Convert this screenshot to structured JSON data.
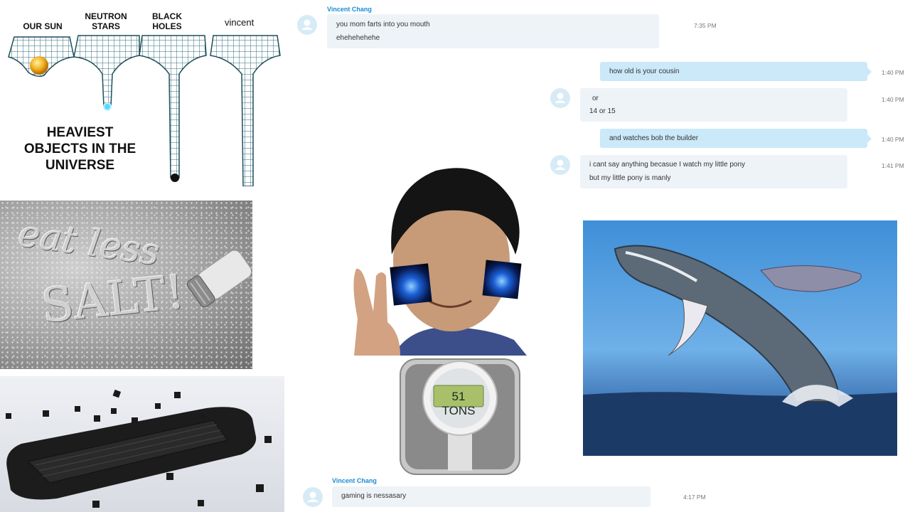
{
  "universe": {
    "labels": [
      "OUR SUN",
      "NEUTRON\nSTARS",
      "BLACK\nHOLES"
    ],
    "vincent_label": "vincent",
    "title": "HEAVIEST\nOBJECTS IN THE\nUNIVERSE"
  },
  "salt": {
    "line1": "eat less",
    "line2": "SALT!"
  },
  "scale": {
    "readout": "51 TONS"
  },
  "chat": {
    "sender_name": "Vincent Chang",
    "messages": [
      {
        "lines": [
          "you mom farts into you mouth",
          "ehehehehehe"
        ],
        "time": "7:35 PM"
      },
      {
        "lines": [
          "how old is your cousin"
        ],
        "time": "1:40 PM"
      },
      {
        "lines": [
          "or",
          "14 or 15"
        ],
        "time": "1:40 PM"
      },
      {
        "lines": [
          "and watches bob the builder"
        ],
        "time": "1:40 PM"
      },
      {
        "lines": [
          "i cant say anything becasue I watch my little pony",
          "but my little pony is manly"
        ],
        "time": "1:41 PM"
      },
      {
        "lines": [
          "gaming is nessasary"
        ],
        "time": "4:17 PM"
      }
    ]
  },
  "icons": [
    "avatar-icon",
    "water-drop-icon"
  ],
  "colors": {
    "sender": "#1a8bd1",
    "bubble_in": "#eef3f8",
    "bubble_out": "#cbe9f9",
    "avatar": "#d6ebf6"
  }
}
